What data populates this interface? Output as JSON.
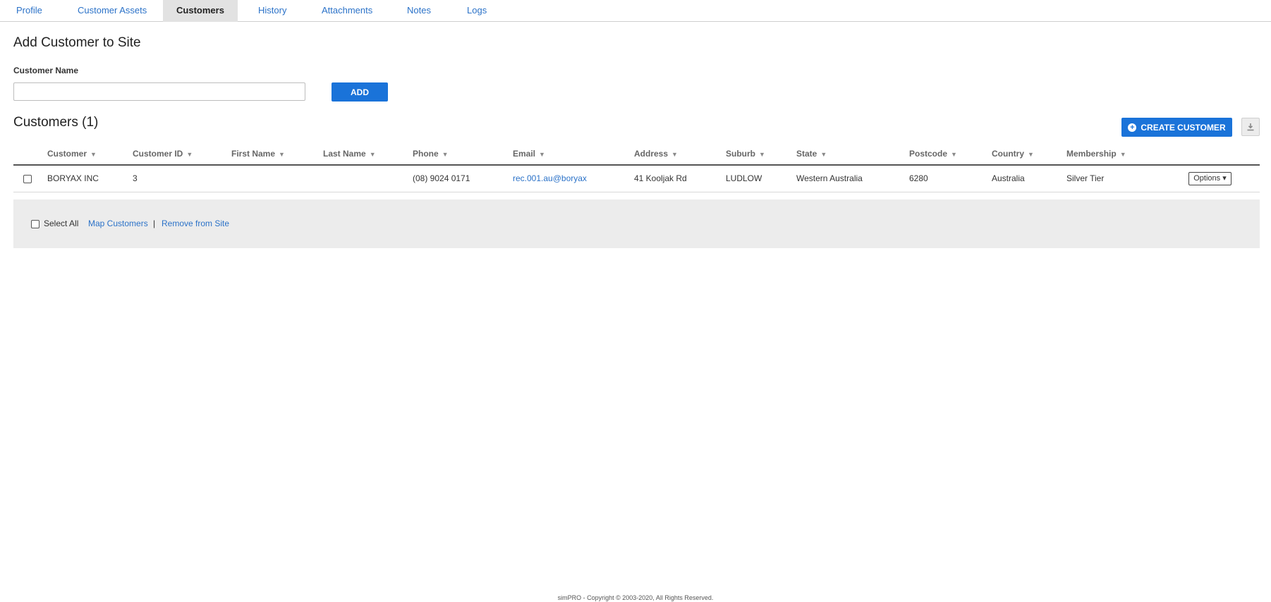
{
  "tabs": [
    {
      "label": "Profile"
    },
    {
      "label": "Customer Assets"
    },
    {
      "label": "Customers"
    },
    {
      "label": "History"
    },
    {
      "label": "Attachments"
    },
    {
      "label": "Notes"
    },
    {
      "label": "Logs"
    }
  ],
  "active_tab": "Customers",
  "add_section": {
    "title": "Add Customer to Site",
    "field_label": "Customer Name",
    "input_value": "",
    "add_button": "ADD"
  },
  "customers_section": {
    "title": "Customers (1)",
    "create_button": "CREATE CUSTOMER",
    "download_icon": "download-icon"
  },
  "table": {
    "columns": [
      "Customer",
      "Customer ID",
      "First Name",
      "Last Name",
      "Phone",
      "Email",
      "Address",
      "Suburb",
      "State",
      "Postcode",
      "Country",
      "Membership"
    ],
    "rows": [
      {
        "customer": "BORYAX INC",
        "customer_id": "3",
        "first_name": "",
        "last_name": "",
        "phone": "(08) 9024 0171",
        "email": "rec.001.au@boryax",
        "address": "41 Kooljak Rd",
        "suburb": "LUDLOW",
        "state": "Western Australia",
        "postcode": "6280",
        "country": "Australia",
        "membership": "Silver Tier",
        "options_label": "Options ▾"
      }
    ]
  },
  "bulk_actions": {
    "select_all": "Select All",
    "map_customers": "Map Customers",
    "separator": "|",
    "remove_from_site": "Remove from Site"
  },
  "footer": {
    "copyright": "simPRO - Copyright © 2003-2020, All Rights Reserved."
  },
  "colors": {
    "primary": "#1a73d9",
    "link": "#2b72c8",
    "active_tab_bg": "#e2e2e2",
    "bar_bg": "#ececec"
  }
}
